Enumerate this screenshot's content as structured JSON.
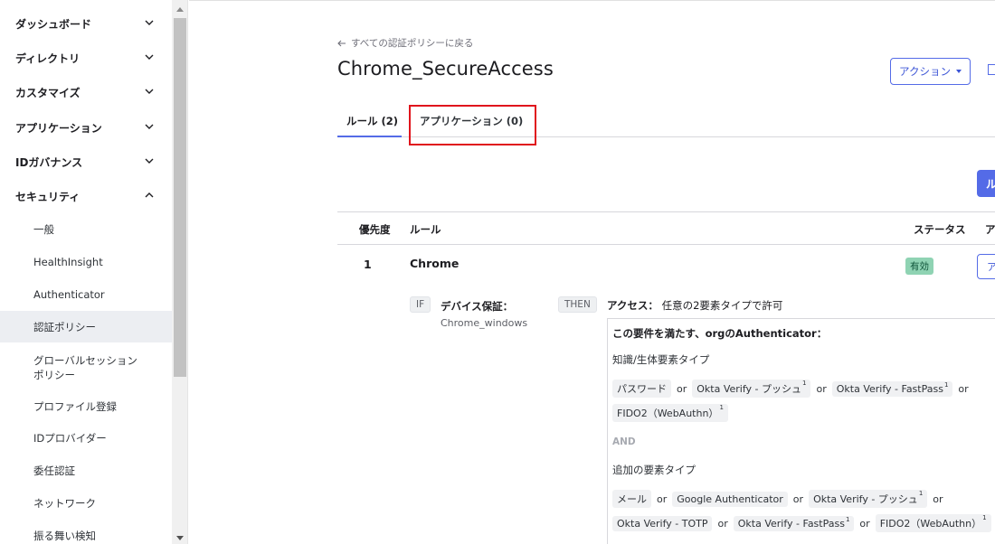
{
  "sidebar": {
    "top_items": [
      {
        "label": "ダッシュボード",
        "expanded": false
      },
      {
        "label": "ディレクトリ",
        "expanded": false
      },
      {
        "label": "カスタマイズ",
        "expanded": false
      },
      {
        "label": "アプリケーション",
        "expanded": false
      },
      {
        "label": "IDガバナンス",
        "expanded": false
      },
      {
        "label": "セキュリティ",
        "expanded": true
      }
    ],
    "security_items": [
      {
        "label": "一般"
      },
      {
        "label": "HealthInsight"
      },
      {
        "label": "Authenticator"
      },
      {
        "label": "認証ポリシー",
        "active": true
      },
      {
        "label": "グローバルセッション\nポリシー"
      },
      {
        "label": "プロファイル登録"
      },
      {
        "label": "IDプロバイダー"
      },
      {
        "label": "委任認証"
      },
      {
        "label": "ネットワーク"
      },
      {
        "label": "振る舞い検知"
      }
    ]
  },
  "header": {
    "back_link": "すべての認証ポリシーに戻る",
    "title": "Chrome_SecureAccess",
    "action_button": "アクション"
  },
  "tabs": [
    {
      "label": "ルール (2)",
      "active": true
    },
    {
      "label": "アプリケーション (0)",
      "active": false,
      "highlighted": true
    }
  ],
  "add_rule_button": "ル",
  "table": {
    "headers": {
      "priority": "優先度",
      "rule": "ルール",
      "status": "ステータス",
      "actions": "ア"
    },
    "rows": [
      {
        "priority": "1",
        "name": "Chrome",
        "status": "有効",
        "action_button": "ア",
        "if_tag": "IF",
        "condition_label": "デバイス保証：",
        "condition_value": "Chrome_windows",
        "then_tag": "THEN",
        "access_label": "アクセス：",
        "access_value": "任意の2要素タイプで許可",
        "auth_title": "この要件を満たす、orgのAuthenticator：",
        "group1_title": "知識/生体要素タイプ",
        "group1_row1": [
          {
            "label": "パスワード",
            "sup": ""
          },
          {
            "label": "Okta Verify - プッシュ",
            "sup": "1"
          },
          {
            "label": "Okta Verify - FastPass",
            "sup": "1"
          }
        ],
        "group1_row2": [
          {
            "label": "FIDO2（WebAuthn）",
            "sup": "1"
          }
        ],
        "and_label": "AND",
        "group2_title": "追加の要素タイプ",
        "group2_row1": [
          {
            "label": "メール",
            "sup": ""
          },
          {
            "label": "Google Authenticator",
            "sup": ""
          },
          {
            "label": "Okta Verify - プッシュ",
            "sup": "1"
          }
        ],
        "group2_row2": [
          {
            "label": "Okta Verify - TOTP",
            "sup": ""
          },
          {
            "label": "Okta Verify - FastPass",
            "sup": "1"
          },
          {
            "label": "FIDO2（WebAuthn）",
            "sup": "1"
          }
        ],
        "or_word": "or"
      }
    ]
  },
  "colors": {
    "accent": "#546be7",
    "highlight_box": "#e0141c",
    "status_active_bg": "#8fd3b3",
    "status_active_text": "#0d5237"
  }
}
